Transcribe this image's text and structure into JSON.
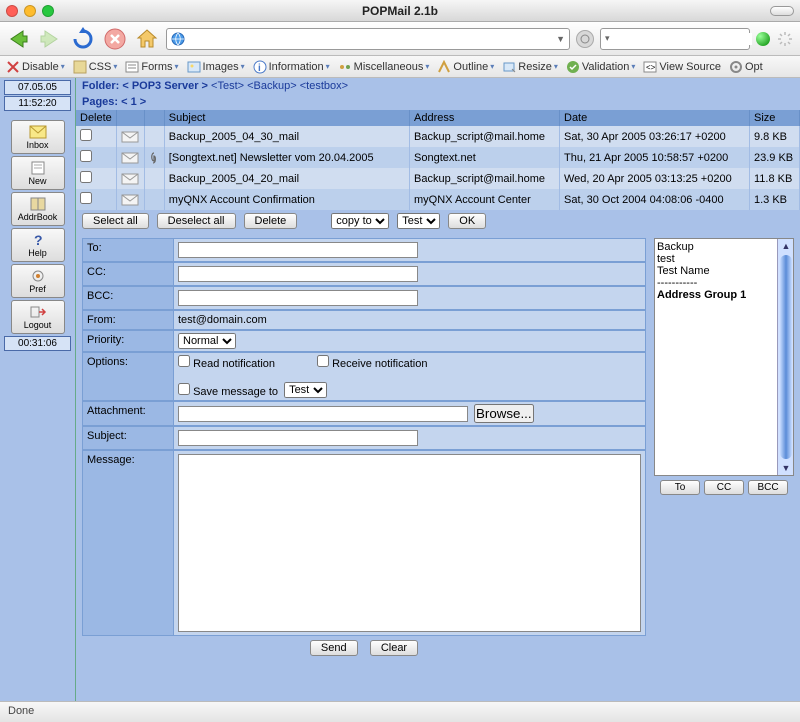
{
  "window": {
    "title": "POPMail 2.1b"
  },
  "webdev": {
    "disable": "Disable",
    "css": "CSS",
    "forms": "Forms",
    "images": "Images",
    "information": "Information",
    "miscellaneous": "Miscellaneous",
    "outline": "Outline",
    "resize": "Resize",
    "validation": "Validation",
    "view_source": "View Source",
    "options": "Opt"
  },
  "sidebar": {
    "date": "07.05.05",
    "time": "11:52:20",
    "buttons": [
      {
        "label": "Inbox"
      },
      {
        "label": "New"
      },
      {
        "label": "AddrBook"
      },
      {
        "label": "Help"
      },
      {
        "label": "Pref"
      },
      {
        "label": "Logout"
      }
    ],
    "timer": "00:31:06"
  },
  "folder": {
    "label": "Folder:",
    "server": "< POP3 Server >",
    "path": [
      "<Test>",
      "<Backup>",
      "<testbox>"
    ]
  },
  "pages": {
    "label": "Pages:",
    "current": "< 1 >"
  },
  "mail_headers": {
    "delete": "Delete",
    "subject": "Subject",
    "address": "Address",
    "date": "Date",
    "size": "Size"
  },
  "messages": [
    {
      "attach": false,
      "subject": "Backup_2005_04_30_mail",
      "address": "Backup_script@mail.home",
      "date": "Sat, 30 Apr 2005 03:26:17 +0200",
      "size": "9.8 KB"
    },
    {
      "attach": true,
      "subject": "[Songtext.net] Newsletter vom 20.04.2005",
      "address": "Songtext.net",
      "date": "Thu, 21 Apr 2005 10:58:57 +0200",
      "size": "23.9 KB"
    },
    {
      "attach": false,
      "subject": "Backup_2005_04_20_mail",
      "address": "Backup_script@mail.home",
      "date": "Wed, 20 Apr 2005 03:13:25 +0200",
      "size": "11.8 KB"
    },
    {
      "attach": false,
      "subject": "myQNX Account Confirmation",
      "address": "myQNX Account Center",
      "date": "Sat, 30 Oct 2004 04:08:06 -0400",
      "size": "1.3 KB"
    }
  ],
  "actions": {
    "select_all": "Select all",
    "deselect_all": "Deselect all",
    "delete": "Delete",
    "batch_action": "copy to",
    "batch_target": "Test",
    "ok": "OK"
  },
  "compose": {
    "labels": {
      "to": "To:",
      "cc": "CC:",
      "bcc": "BCC:",
      "from": "From:",
      "priority": "Priority:",
      "options": "Options:",
      "attachment": "Attachment:",
      "subject": "Subject:",
      "message": "Message:"
    },
    "from": "test@domain.com",
    "priority": "Normal",
    "read_notification": "Read notification",
    "receive_notification": "Receive notification",
    "save_message_to": "Save message to",
    "save_target": "Test",
    "browse": "Browse...",
    "send": "Send",
    "clear": "Clear"
  },
  "addressbook": {
    "entries": [
      "Backup",
      "test",
      "Test Name",
      "-----------",
      "Address Group 1"
    ],
    "entry_bold": [
      false,
      false,
      false,
      false,
      true
    ],
    "to": "To",
    "cc": "CC",
    "bcc": "BCC"
  },
  "status": "Done"
}
